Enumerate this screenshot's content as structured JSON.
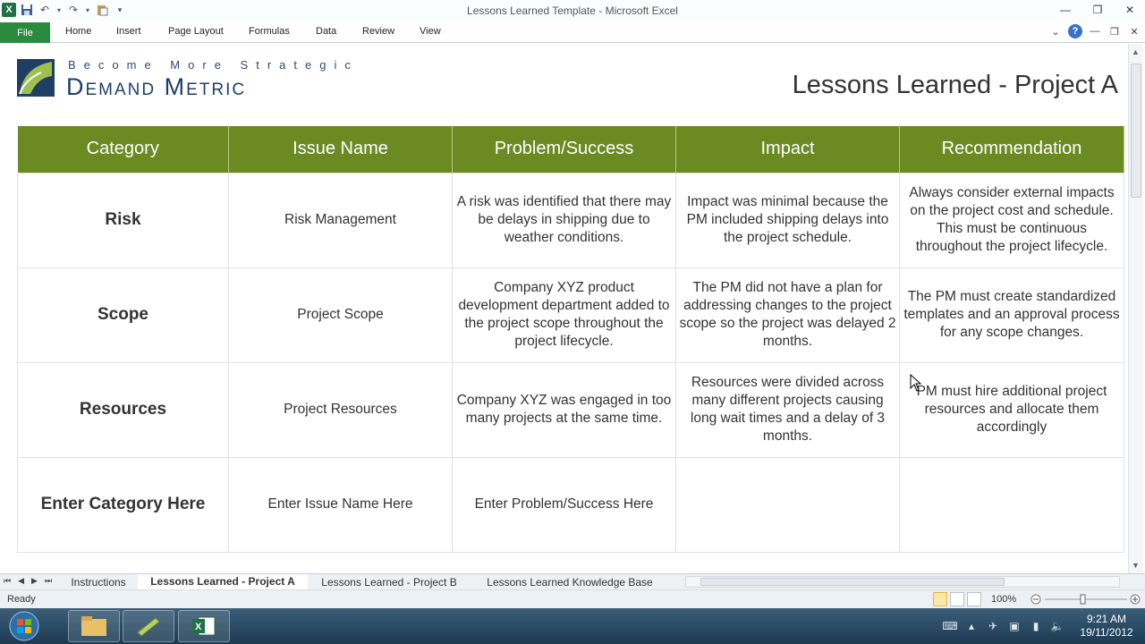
{
  "window": {
    "title": "Lessons Learned Template - Microsoft Excel",
    "app_icon": "excel-icon"
  },
  "ribbon": {
    "file_label": "File",
    "tabs": [
      "Home",
      "Insert",
      "Page Layout",
      "Formulas",
      "Data",
      "Review",
      "View"
    ]
  },
  "header": {
    "tagline": "Become More Strategic",
    "brand": "Demand Metric",
    "page_title": "Lessons Learned - Project A"
  },
  "table": {
    "columns": [
      "Category",
      "Issue Name",
      "Problem/Success",
      "Impact",
      "Recommendation"
    ],
    "rows": [
      {
        "category": "Risk",
        "issue": "Risk Management",
        "problem": "A risk was identified that there may be delays in shipping due to weather conditions.",
        "impact": "Impact was minimal because the PM included shipping delays into the project schedule.",
        "recommendation": "Always consider external impacts on the project cost and schedule. This must be continuous throughout the project lifecycle."
      },
      {
        "category": "Scope",
        "issue": "Project Scope",
        "problem": "Company XYZ product development department added to the project scope throughout the project lifecycle.",
        "impact": "The PM did not have a plan for addressing changes to the project scope so the project was delayed 2 months.",
        "recommendation": "The PM must create standardized templates and an approval process for any scope changes."
      },
      {
        "category": "Resources",
        "issue": "Project Resources",
        "problem": "Company XYZ was engaged in too many projects at the same time.",
        "impact": "Resources were divided across many different projects causing long wait times and a delay of 3 months.",
        "recommendation": "PM must hire additional project resources and allocate them accordingly"
      },
      {
        "category": "Enter Category Here",
        "issue": "Enter Issue Name Here",
        "problem": "Enter Problem/Success Here",
        "impact": "",
        "recommendation": ""
      }
    ]
  },
  "sheet_tabs": [
    "Instructions",
    "Lessons Learned - Project A",
    "Lessons Learned - Project B",
    "Lessons Learned Knowledge Base"
  ],
  "active_sheet_index": 1,
  "status": {
    "text": "Ready",
    "zoom": "100%"
  },
  "taskbar": {
    "time": "9:21 AM",
    "date": "19/11/2012"
  },
  "colors": {
    "header_green": "#6b8a22",
    "file_tab_green": "#2a8a3e",
    "brand_blue": "#1f3e66"
  }
}
